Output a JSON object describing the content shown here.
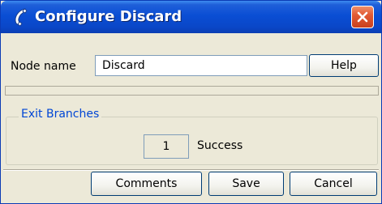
{
  "window": {
    "title": "Configure Discard",
    "title_icon": "phone-handset-icon",
    "close_icon": "close-icon",
    "colors": {
      "titlebar": "#0a4ed4",
      "close_button": "#e25a34",
      "dialog_background": "#ece9d8",
      "legend_text": "#0046d5"
    }
  },
  "node": {
    "label": "Node name",
    "value": "Discard",
    "help_label": "Help"
  },
  "exit_branches": {
    "legend": "Exit Branches",
    "items": [
      {
        "number": "1",
        "label": "Success"
      }
    ]
  },
  "footer": {
    "comments_label": "Comments",
    "save_label": "Save",
    "cancel_label": "Cancel"
  }
}
